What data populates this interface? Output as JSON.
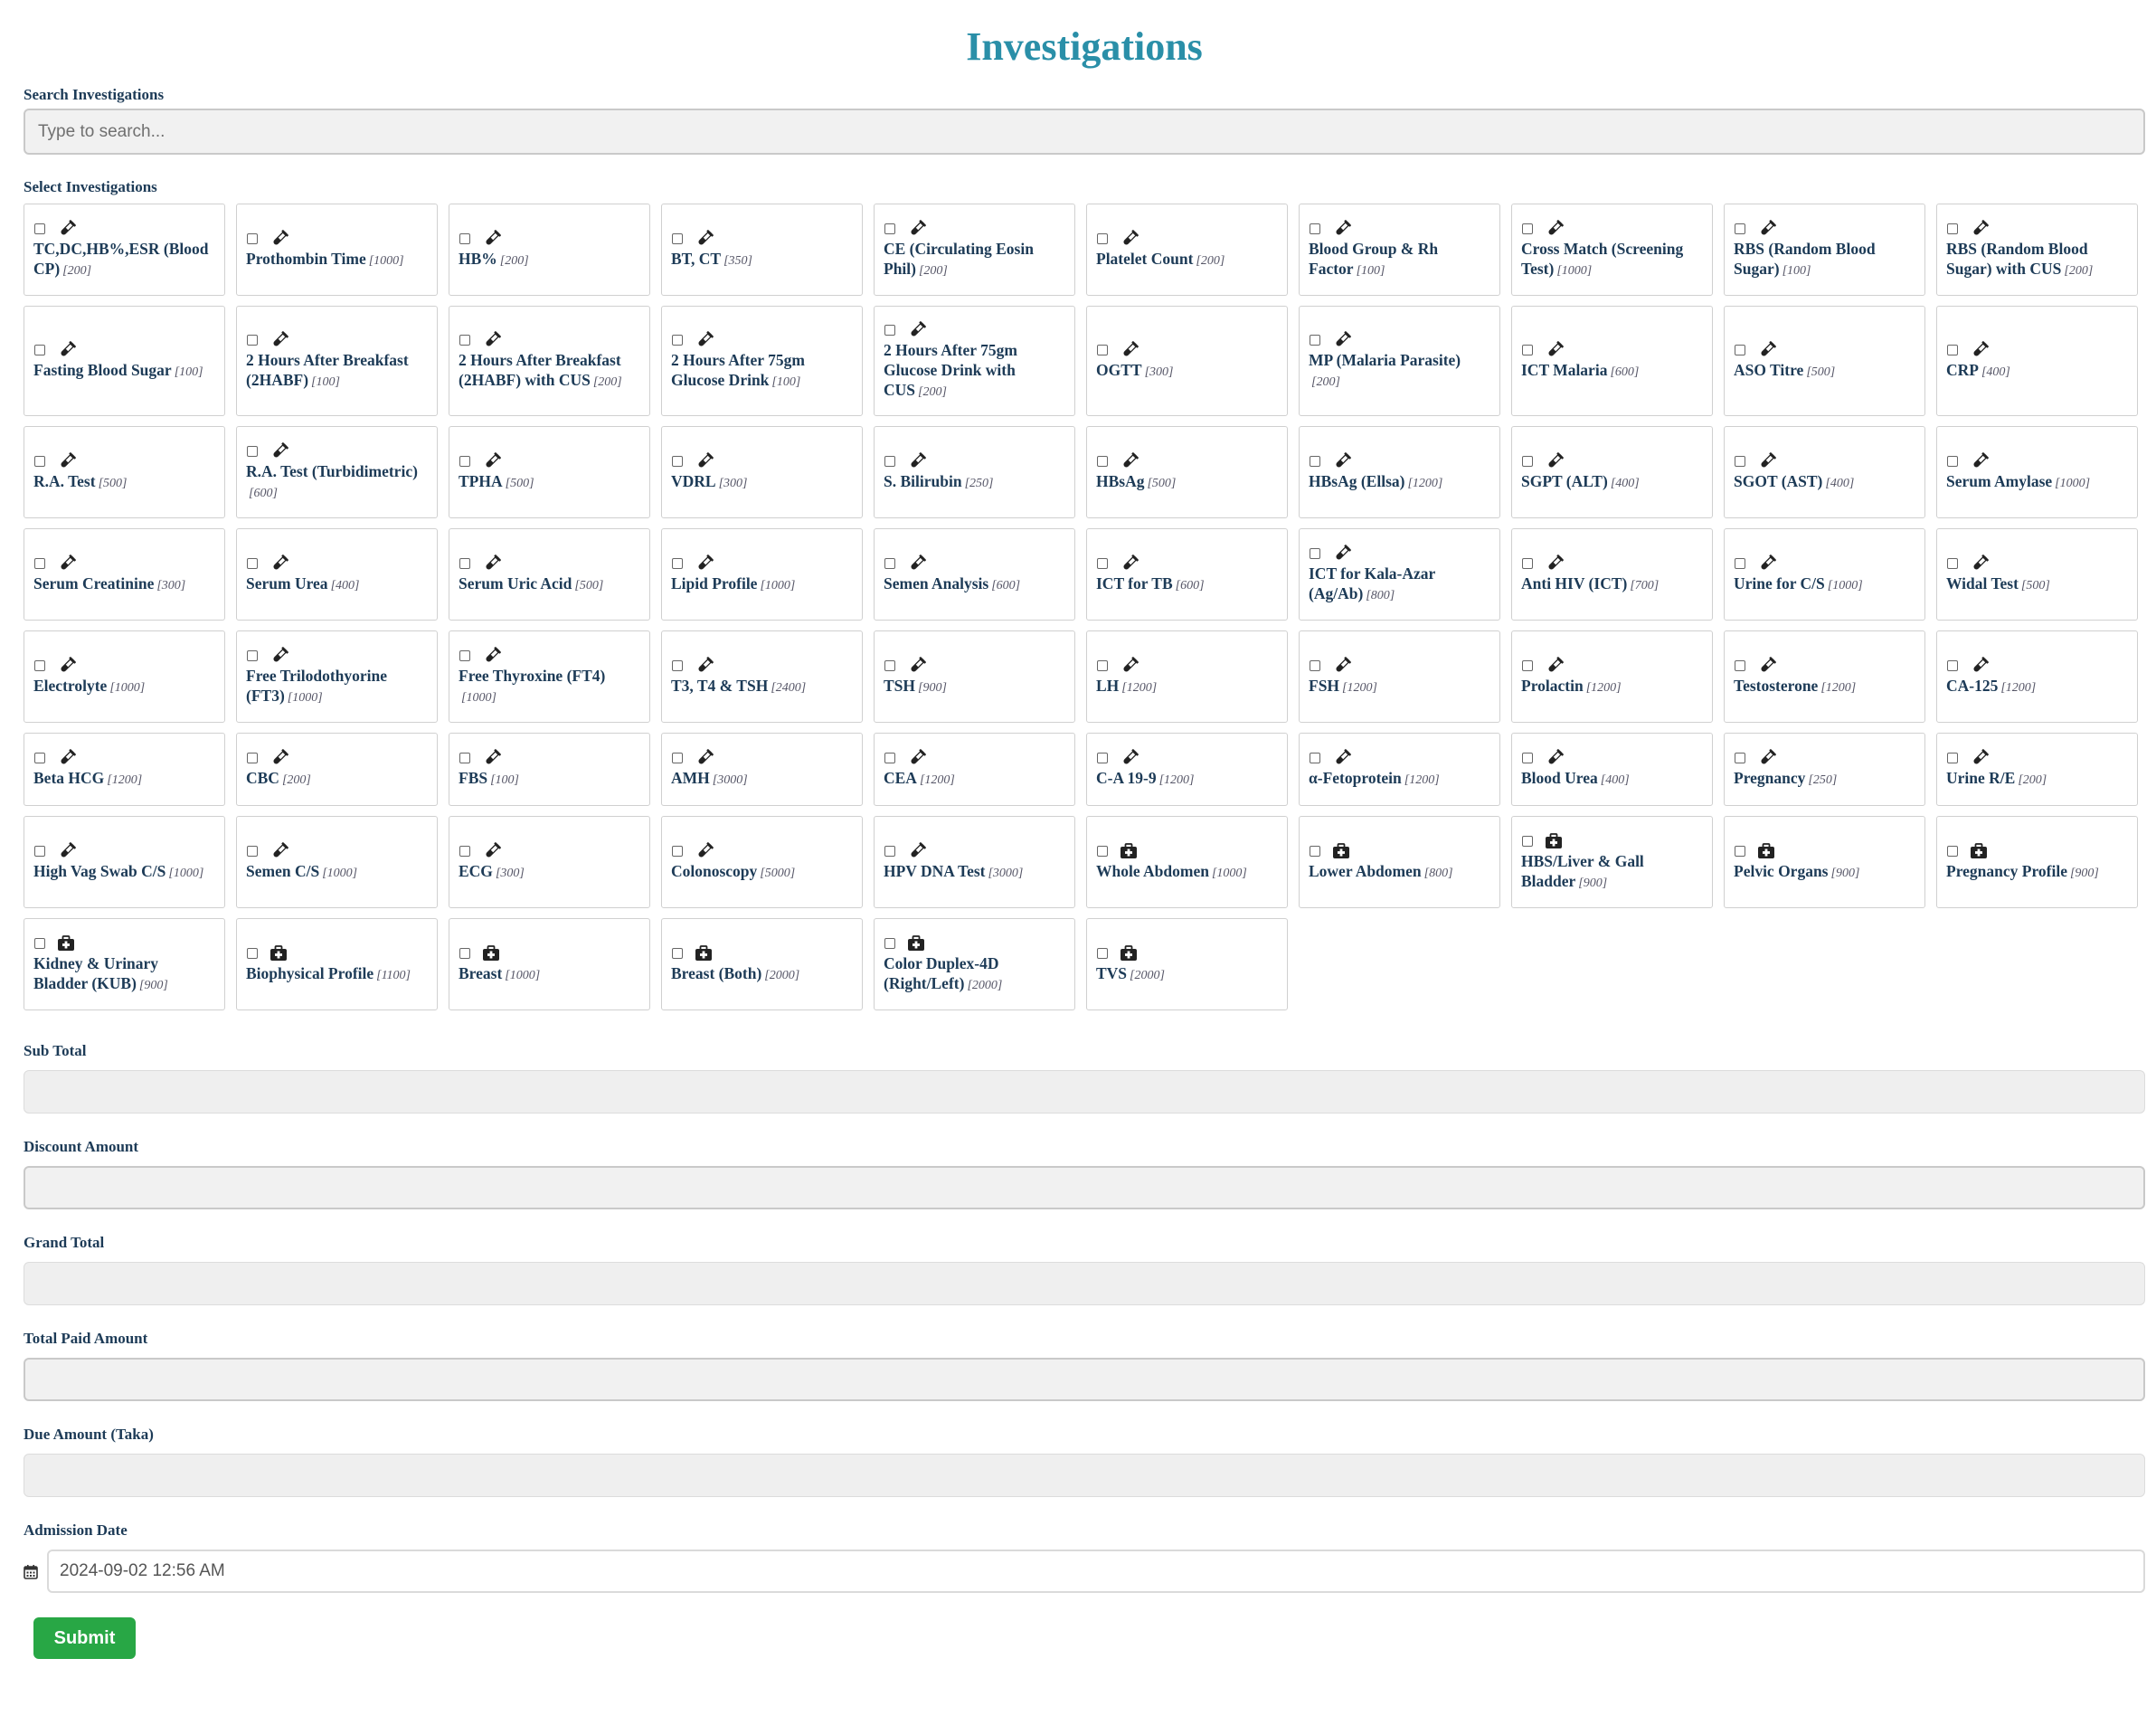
{
  "title": "Investigations",
  "search": {
    "label": "Search Investigations",
    "placeholder": "Type to search..."
  },
  "select_label": "Select Investigations",
  "investigations": [
    {
      "name": "TC,DC,HB%,ESR (Blood CP)",
      "price": "[200]",
      "icon": "test-tube-icon"
    },
    {
      "name": "Prothombin Time",
      "price": "[1000]",
      "icon": "test-tube-icon"
    },
    {
      "name": "HB%",
      "price": "[200]",
      "icon": "test-tube-icon"
    },
    {
      "name": "BT, CT",
      "price": "[350]",
      "icon": "test-tube-icon"
    },
    {
      "name": "CE (Circulating Eosin Phil)",
      "price": "[200]",
      "icon": "test-tube-icon"
    },
    {
      "name": "Platelet Count",
      "price": "[200]",
      "icon": "test-tube-icon"
    },
    {
      "name": "Blood Group & Rh Factor",
      "price": "[100]",
      "icon": "test-tube-icon"
    },
    {
      "name": "Cross Match (Screening Test)",
      "price": "[1000]",
      "icon": "test-tube-icon"
    },
    {
      "name": "RBS (Random Blood Sugar)",
      "price": "[100]",
      "icon": "test-tube-icon"
    },
    {
      "name": "RBS (Random Blood Sugar) with CUS",
      "price": "[200]",
      "icon": "test-tube-icon"
    },
    {
      "name": "Fasting Blood Sugar",
      "price": "[100]",
      "icon": "test-tube-icon"
    },
    {
      "name": "2 Hours After Breakfast (2HABF)",
      "price": "[100]",
      "icon": "test-tube-icon"
    },
    {
      "name": "2 Hours After Breakfast (2HABF) with CUS",
      "price": "[200]",
      "icon": "test-tube-icon"
    },
    {
      "name": "2 Hours After 75gm Glucose Drink",
      "price": "[100]",
      "icon": "test-tube-icon"
    },
    {
      "name": "2 Hours After 75gm Glucose Drink with CUS",
      "price": "[200]",
      "icon": "test-tube-icon"
    },
    {
      "name": "OGTT",
      "price": "[300]",
      "icon": "test-tube-icon"
    },
    {
      "name": "MP (Malaria Parasite)",
      "price": "[200]",
      "icon": "test-tube-icon"
    },
    {
      "name": "ICT Malaria",
      "price": "[600]",
      "icon": "test-tube-icon"
    },
    {
      "name": "ASO Titre",
      "price": "[500]",
      "icon": "test-tube-icon"
    },
    {
      "name": "CRP",
      "price": "[400]",
      "icon": "test-tube-icon"
    },
    {
      "name": "R.A. Test",
      "price": "[500]",
      "icon": "test-tube-icon"
    },
    {
      "name": "R.A. Test (Turbidimetric)",
      "price": "[600]",
      "icon": "test-tube-icon"
    },
    {
      "name": "TPHA",
      "price": "[500]",
      "icon": "test-tube-icon"
    },
    {
      "name": "VDRL",
      "price": "[300]",
      "icon": "test-tube-icon"
    },
    {
      "name": "S. Bilirubin",
      "price": "[250]",
      "icon": "test-tube-icon"
    },
    {
      "name": "HBsAg",
      "price": "[500]",
      "icon": "test-tube-icon"
    },
    {
      "name": "HBsAg (Ellsa)",
      "price": "[1200]",
      "icon": "test-tube-icon"
    },
    {
      "name": "SGPT (ALT)",
      "price": "[400]",
      "icon": "test-tube-icon"
    },
    {
      "name": "SGOT (AST)",
      "price": "[400]",
      "icon": "test-tube-icon"
    },
    {
      "name": "Serum Amylase",
      "price": "[1000]",
      "icon": "test-tube-icon"
    },
    {
      "name": "Serum Creatinine",
      "price": "[300]",
      "icon": "test-tube-icon"
    },
    {
      "name": "Serum Urea",
      "price": "[400]",
      "icon": "test-tube-icon"
    },
    {
      "name": "Serum Uric Acid",
      "price": "[500]",
      "icon": "test-tube-icon"
    },
    {
      "name": "Lipid Profile",
      "price": "[1000]",
      "icon": "test-tube-icon"
    },
    {
      "name": "Semen Analysis",
      "price": "[600]",
      "icon": "test-tube-icon"
    },
    {
      "name": "ICT for TB",
      "price": "[600]",
      "icon": "test-tube-icon"
    },
    {
      "name": "ICT for Kala-Azar (Ag/Ab)",
      "price": "[800]",
      "icon": "test-tube-icon"
    },
    {
      "name": "Anti HIV (ICT)",
      "price": "[700]",
      "icon": "test-tube-icon"
    },
    {
      "name": "Urine for C/S",
      "price": "[1000]",
      "icon": "test-tube-icon"
    },
    {
      "name": "Widal Test",
      "price": "[500]",
      "icon": "test-tube-icon"
    },
    {
      "name": "Electrolyte",
      "price": "[1000]",
      "icon": "test-tube-icon"
    },
    {
      "name": "Free Trilodothyorine (FT3)",
      "price": "[1000]",
      "icon": "test-tube-icon"
    },
    {
      "name": "Free Thyroxine (FT4)",
      "price": "[1000]",
      "icon": "test-tube-icon"
    },
    {
      "name": "T3, T4 & TSH",
      "price": "[2400]",
      "icon": "test-tube-icon"
    },
    {
      "name": "TSH",
      "price": "[900]",
      "icon": "test-tube-icon"
    },
    {
      "name": "LH",
      "price": "[1200]",
      "icon": "test-tube-icon"
    },
    {
      "name": "FSH",
      "price": "[1200]",
      "icon": "test-tube-icon"
    },
    {
      "name": "Prolactin",
      "price": "[1200]",
      "icon": "test-tube-icon"
    },
    {
      "name": "Testosterone",
      "price": "[1200]",
      "icon": "test-tube-icon"
    },
    {
      "name": "CA-125",
      "price": "[1200]",
      "icon": "test-tube-icon"
    },
    {
      "name": "Beta HCG",
      "price": "[1200]",
      "icon": "test-tube-icon"
    },
    {
      "name": "CBC",
      "price": "[200]",
      "icon": "test-tube-icon"
    },
    {
      "name": "FBS",
      "price": "[100]",
      "icon": "test-tube-icon"
    },
    {
      "name": "AMH",
      "price": "[3000]",
      "icon": "test-tube-icon"
    },
    {
      "name": "CEA",
      "price": "[1200]",
      "icon": "test-tube-icon"
    },
    {
      "name": "C-A 19-9",
      "price": "[1200]",
      "icon": "test-tube-icon"
    },
    {
      "name": "α-Fetoprotein",
      "price": "[1200]",
      "icon": "test-tube-icon"
    },
    {
      "name": "Blood Urea",
      "price": "[400]",
      "icon": "test-tube-icon"
    },
    {
      "name": "Pregnancy",
      "price": "[250]",
      "icon": "test-tube-icon"
    },
    {
      "name": "Urine R/E",
      "price": "[200]",
      "icon": "test-tube-icon"
    },
    {
      "name": "High Vag Swab C/S",
      "price": "[1000]",
      "icon": "test-tube-icon"
    },
    {
      "name": "Semen C/S",
      "price": "[1000]",
      "icon": "test-tube-icon"
    },
    {
      "name": "ECG",
      "price": "[300]",
      "icon": "test-tube-icon"
    },
    {
      "name": "Colonoscopy",
      "price": "[5000]",
      "icon": "test-tube-icon"
    },
    {
      "name": "HPV DNA Test",
      "price": "[3000]",
      "icon": "test-tube-icon"
    },
    {
      "name": "Whole Abdomen",
      "price": "[1000]",
      "icon": "medical-kit-icon"
    },
    {
      "name": "Lower Abdomen",
      "price": "[800]",
      "icon": "medical-kit-icon"
    },
    {
      "name": "HBS/Liver & Gall Bladder",
      "price": "[900]",
      "icon": "medical-kit-icon"
    },
    {
      "name": "Pelvic Organs",
      "price": "[900]",
      "icon": "medical-kit-icon"
    },
    {
      "name": "Pregnancy Profile",
      "price": "[900]",
      "icon": "medical-kit-icon"
    },
    {
      "name": "Kidney & Urinary Bladder (KUB)",
      "price": "[900]",
      "icon": "medical-kit-icon"
    },
    {
      "name": "Biophysical Profile",
      "price": "[1100]",
      "icon": "medical-kit-icon"
    },
    {
      "name": "Breast",
      "price": "[1000]",
      "icon": "medical-kit-icon"
    },
    {
      "name": "Breast (Both)",
      "price": "[2000]",
      "icon": "medical-kit-icon"
    },
    {
      "name": "Color Duplex-4D (Right/Left)",
      "price": "[2000]",
      "icon": "medical-kit-icon"
    },
    {
      "name": "TVS",
      "price": "[2000]",
      "icon": "medical-kit-icon"
    }
  ],
  "fields": {
    "sub_total": {
      "label": "Sub Total",
      "value": ""
    },
    "discount_amount": {
      "label": "Discount Amount",
      "value": ""
    },
    "grand_total": {
      "label": "Grand Total",
      "value": ""
    },
    "total_paid_amount": {
      "label": "Total Paid Amount",
      "value": ""
    },
    "due_amount": {
      "label": "Due Amount (Taka)",
      "value": ""
    }
  },
  "admission_date": {
    "label": "Admission Date",
    "value": "2024-09-02 12:56 AM",
    "icon": "calendar-icon"
  },
  "submit_label": "Submit",
  "colors": {
    "title": "#2a8fa8",
    "label": "#1d3b57",
    "submit": "#28a745"
  }
}
